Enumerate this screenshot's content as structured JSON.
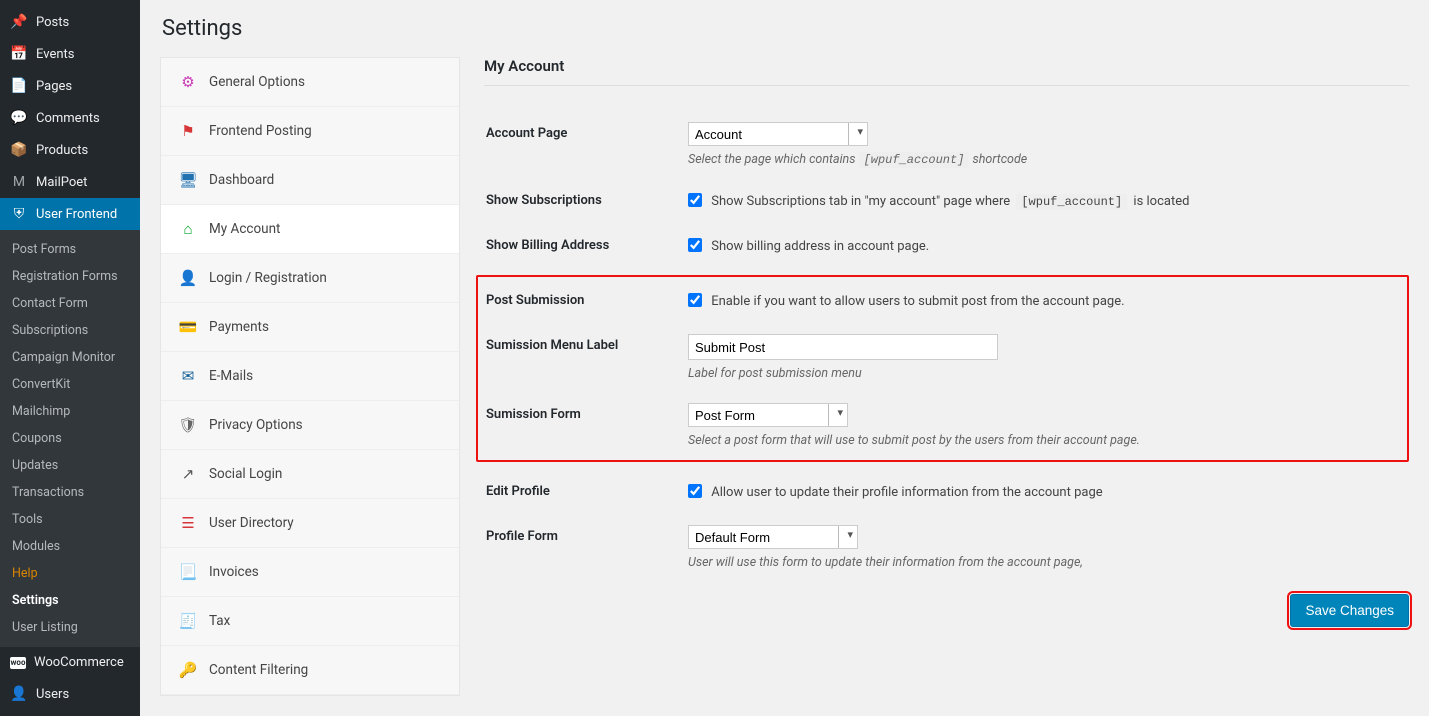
{
  "pageTitle": "Settings",
  "adminMenu": {
    "top": [
      {
        "label": "Posts",
        "icon": "📌"
      },
      {
        "label": "Events",
        "icon": "📅"
      },
      {
        "label": "Pages",
        "icon": "📄"
      },
      {
        "label": "Comments",
        "icon": "💬"
      },
      {
        "label": "Products",
        "icon": "📦"
      },
      {
        "label": "MailPoet",
        "icon": "M"
      }
    ],
    "active": {
      "label": "User Frontend",
      "icon": "UF"
    },
    "sub": [
      {
        "label": "Post Forms"
      },
      {
        "label": "Registration Forms"
      },
      {
        "label": "Contact Form"
      },
      {
        "label": "Subscriptions"
      },
      {
        "label": "Campaign Monitor"
      },
      {
        "label": "ConvertKit"
      },
      {
        "label": "Mailchimp"
      },
      {
        "label": "Coupons"
      },
      {
        "label": "Updates"
      },
      {
        "label": "Transactions"
      },
      {
        "label": "Tools"
      },
      {
        "label": "Modules"
      },
      {
        "label": "Help",
        "help": true
      },
      {
        "label": "Settings",
        "selected": true
      },
      {
        "label": "User Listing"
      }
    ],
    "bottom": [
      {
        "label": "WooCommerce",
        "icon": "woo"
      },
      {
        "label": "Users",
        "icon": "👤"
      }
    ]
  },
  "settingsTabs": [
    {
      "label": "General Options",
      "icon": "⚙",
      "color": "#c939b5"
    },
    {
      "label": "Frontend Posting",
      "icon": "⚑",
      "color": "#d63638"
    },
    {
      "label": "Dashboard",
      "icon": "🖥",
      "color": "#2271b1"
    },
    {
      "label": "My Account",
      "icon": "⌂",
      "color": "#00a32a",
      "active": true
    },
    {
      "label": "Login / Registration",
      "icon": "👤",
      "color": "#2271b1"
    },
    {
      "label": "Payments",
      "icon": "💳",
      "color": "#d98500"
    },
    {
      "label": "E-Mails",
      "icon": "✉",
      "color": "#135e96"
    },
    {
      "label": "Privacy Options",
      "icon": "🛡",
      "color": "#666"
    },
    {
      "label": "Social Login",
      "icon": "↗",
      "color": "#555"
    },
    {
      "label": "User Directory",
      "icon": "☰",
      "color": "#d63638"
    },
    {
      "label": "Invoices",
      "icon": "📃",
      "color": "#00a32a"
    },
    {
      "label": "Tax",
      "icon": "🧾",
      "color": "#555"
    },
    {
      "label": "Content Filtering",
      "icon": "🔑",
      "color": "#555"
    }
  ],
  "panel": {
    "title": "My Account",
    "accountPage": {
      "label": "Account Page",
      "selected": "Account",
      "descPrefix": "Select the page which contains ",
      "code": "[wpuf_account]",
      "descSuffix": " shortcode"
    },
    "showSubscriptions": {
      "label": "Show Subscriptions",
      "checked": true,
      "textPrefix": "Show Subscriptions tab in \"my account\" page where ",
      "code": "[wpuf_account]",
      "textSuffix": " is located"
    },
    "showBilling": {
      "label": "Show Billing Address",
      "checked": true,
      "text": "Show billing address in account page."
    },
    "postSubmission": {
      "label": "Post Submission",
      "checked": true,
      "text": "Enable if you want to allow users to submit post from the account page."
    },
    "submissionMenuLabel": {
      "label": "Sumission Menu Label",
      "value": "Submit Post",
      "desc": "Label for post submission menu"
    },
    "submissionForm": {
      "label": "Sumission Form",
      "selected": "Post Form",
      "desc": "Select a post form that will use to submit post by the users from their account page."
    },
    "editProfile": {
      "label": "Edit Profile",
      "checked": true,
      "text": "Allow user to update their profile information from the account page"
    },
    "profileForm": {
      "label": "Profile Form",
      "selected": "Default Form",
      "desc": "User will use this form to update their information from the account page,"
    }
  },
  "saveButton": "Save Changes"
}
